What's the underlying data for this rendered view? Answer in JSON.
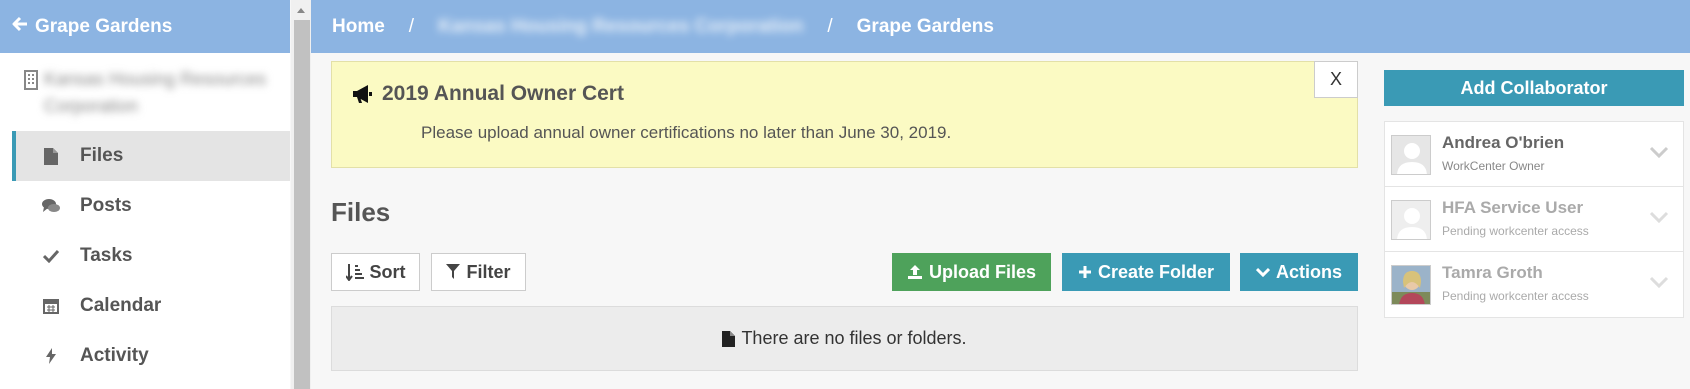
{
  "sidebar": {
    "back_label": "Grape Gardens",
    "org_name": "Kansas Housing Resources Corporation",
    "items": [
      {
        "label": "Files",
        "icon": "file-icon"
      },
      {
        "label": "Posts",
        "icon": "comments-icon"
      },
      {
        "label": "Tasks",
        "icon": "check-icon"
      },
      {
        "label": "Calendar",
        "icon": "calendar-icon"
      },
      {
        "label": "Activity",
        "icon": "bolt-icon"
      }
    ],
    "active_index": 0
  },
  "breadcrumb": {
    "home": "Home",
    "separator": "/",
    "org": "Kansas Housing Resources Corporation",
    "current": "Grape Gardens"
  },
  "banner": {
    "title": "2019 Annual Owner Cert",
    "message": "Please upload annual owner certifications no later than June 30, 2019.",
    "close_label": "X"
  },
  "files": {
    "title": "Files",
    "sort_label": "Sort",
    "filter_label": "Filter",
    "upload_label": "Upload Files",
    "create_folder_label": "Create Folder",
    "actions_label": "Actions",
    "empty_message": "There are no files or folders."
  },
  "collaborators": {
    "add_label": "Add Collaborator",
    "list": [
      {
        "name": "Andrea O'brien",
        "role": "WorkCenter Owner",
        "pending": false
      },
      {
        "name": "HFA Service User",
        "role": "Pending workcenter access",
        "pending": true
      },
      {
        "name": "Tamra Groth",
        "role": "Pending workcenter access",
        "pending": true
      }
    ]
  },
  "colors": {
    "header_blue": "#8cb4e2",
    "teal": "#3a9ab5",
    "green": "#4ea25b",
    "banner_yellow": "#fbfac3"
  }
}
